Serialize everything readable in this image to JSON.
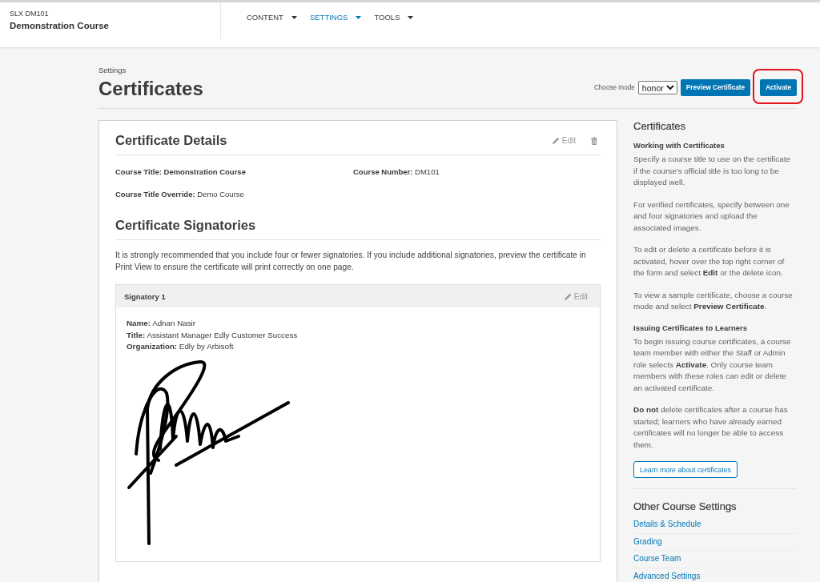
{
  "header": {
    "course_org_number": "SLX DM101",
    "course_name": "Demonstration Course",
    "nav": [
      {
        "label": "CONTENT",
        "selected": false
      },
      {
        "label": "SETTINGS",
        "selected": true
      },
      {
        "label": "TOOLS",
        "selected": false
      }
    ]
  },
  "page_header": {
    "subtitle": "Settings",
    "title": "Certificates",
    "mode_label": "Choose mode",
    "mode_select": {
      "value": "honor"
    },
    "actions": [
      {
        "label": "Preview Certificate",
        "highlighted": false
      },
      {
        "label": "Activate",
        "highlighted": true
      }
    ]
  },
  "certificate_details": {
    "title": "Certificate Details",
    "edit_label": "Edit",
    "fields": [
      {
        "kind": "strong",
        "text": "Course Title: Demonstration Course"
      },
      {
        "kind": "plain",
        "text": "**Course Number:** DM101"
      },
      {
        "kind": "plain",
        "text": "**Course Title Override:** Demo Course"
      }
    ]
  },
  "certificate_signatories": {
    "title": "Certificate Signatories",
    "note": "It is strongly recommended that you include four or fewer signatories. If you include additional signatories, preview the certificate in Print View to ensure the certificate will print correctly on one page.",
    "signatories": [
      {
        "heading": "Signatory 1",
        "edit_label": "Edit",
        "fields": [
          "**Name:** Adnan Nasir",
          "**Title:** Assistant Manager Edly Customer Success",
          "**Organization:** Edly by Arbisoft"
        ]
      }
    ]
  },
  "sidebar": {
    "title": "Certificates",
    "sections": [
      {
        "heading": "Working with Certificates",
        "paragraphs": [
          "Specify a course title to use on the certificate if the course's official title is too long to be displayed well.",
          "For verified certificates, specify between one and four signatories and upload the associated images.",
          "To edit or delete a certificate before it is activated, hover over the top right corner of the form and select **Edit** or the delete icon.",
          "To view a sample certificate, choose a course mode and select **Preview Certificate**."
        ]
      },
      {
        "heading": "Issuing Certificates to Learners",
        "paragraphs": [
          "To begin issuing course certificates, a course team member with either the Staff or Admin role selects **Activate**. Only course team members with these roles can edit or delete an activated certificate.",
          "**Do not** delete certificates after a course has started; learners who have already earned certificates will no longer be able to access them."
        ]
      }
    ],
    "learn_more_button": "Learn more about certificates",
    "other_settings": {
      "title": "Other Course Settings",
      "links": [
        "Details & Schedule",
        "Grading",
        "Course Team",
        "Advanced Settings"
      ]
    }
  }
}
